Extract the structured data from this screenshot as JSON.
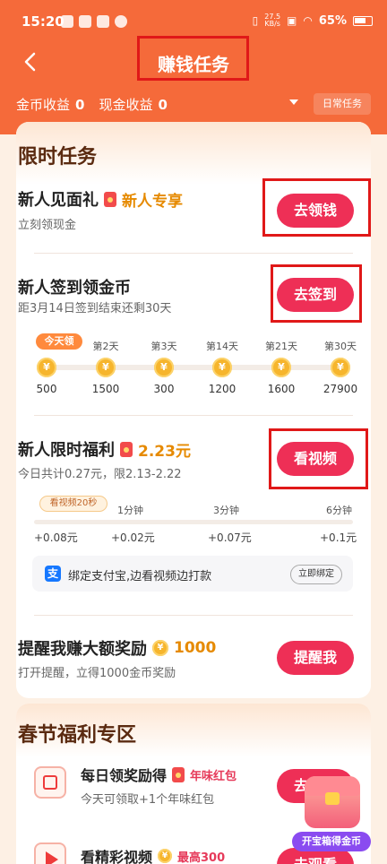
{
  "status_bar": {
    "time": "15:20",
    "net_speed": "27.5",
    "net_unit": "KB/s",
    "battery": "65%"
  },
  "header": {
    "title": "赚钱任务",
    "gold_label": "金币收益",
    "gold_value": "0",
    "cash_label": "现金收益",
    "cash_value": "0",
    "daily_tab": "日常任务"
  },
  "limited": {
    "section_title": "限时任务",
    "gift": {
      "title": "新人见面礼",
      "tag": "新人专享",
      "sub": "立刻领现金",
      "button": "去领钱"
    },
    "signin": {
      "title": "新人签到领金币",
      "sub": "距3月14日签到结束还剩30天",
      "button": "去签到",
      "today_badge": "今天领",
      "days": [
        "第2天",
        "第3天",
        "第14天",
        "第21天",
        "第30天"
      ],
      "amounts": [
        "500",
        "1500",
        "300",
        "1200",
        "1600",
        "27900"
      ]
    },
    "welfare": {
      "title": "新人限时福利",
      "amount": "2.23元",
      "sub": "今日共计0.27元，限2.13-2.22",
      "button": "看视频",
      "badge": "看视频20秒",
      "times": [
        "1分钟",
        "3分钟",
        "6分钟"
      ],
      "bonuses": [
        "+0.08元",
        "+0.02元",
        "+0.07元",
        "+0.1元"
      ]
    },
    "alipay": {
      "text": "绑定支付宝,边看视频边打款",
      "button": "立即绑定",
      "icon": "支"
    },
    "remind": {
      "title": "提醒我赚大额奖励",
      "amount": "1000",
      "sub": "打开提醒，立得1000金币奖励",
      "button": "提醒我"
    }
  },
  "festival": {
    "section_title": "春节福利专区",
    "daily_reward": {
      "title": "每日领奖励得",
      "tag": "年味红包",
      "sub": "今天可领取+1个年味红包",
      "button": "去领取"
    },
    "video": {
      "title": "看精彩视频",
      "tag": "最高300",
      "button": "去观看"
    }
  },
  "floating": {
    "label": "开宝箱得金币"
  },
  "coin_symbol": "¥"
}
